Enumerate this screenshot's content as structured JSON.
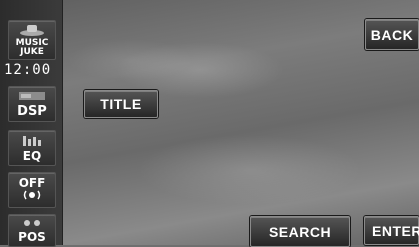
{
  "sidebar": {
    "music_juke": "MUSIC JUKE",
    "dsp": "DSP",
    "eq": "EQ",
    "off": "OFF",
    "pos": "POS",
    "clock": "12:00"
  },
  "buttons": {
    "back": "BACK",
    "title": "TITLE",
    "search": "SEARCH",
    "enter": "ENTER"
  },
  "icons": {
    "music_juke": "music-juke-icon",
    "dsp": "dsp-icon",
    "eq": "equalizer-icon",
    "off": "speaker-off-icon",
    "pos": "seat-position-icon"
  }
}
